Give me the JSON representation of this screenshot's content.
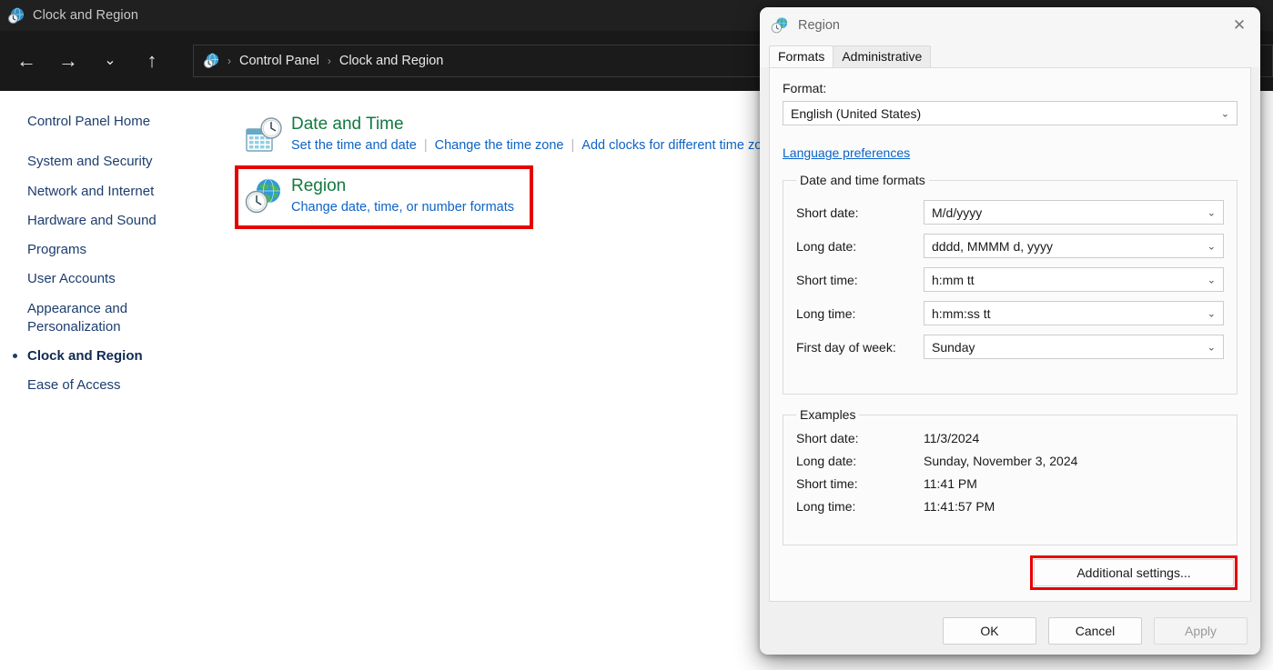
{
  "window": {
    "title": "Clock and Region",
    "title_icon": "clock-globe-icon",
    "nav": {
      "back_icon": "arrow-left-icon",
      "forward_icon": "arrow-right-icon",
      "recent_icon": "chevron-down-icon",
      "up_icon": "arrow-up-icon"
    },
    "breadcrumb": {
      "icon": "clock-globe-icon",
      "sep": "›",
      "items": [
        "Control Panel",
        "Clock and Region"
      ]
    }
  },
  "sidebar": {
    "home": "Control Panel Home",
    "items": [
      {
        "label": "System and Security",
        "current": false
      },
      {
        "label": "Network and Internet",
        "current": false
      },
      {
        "label": "Hardware and Sound",
        "current": false
      },
      {
        "label": "Programs",
        "current": false
      },
      {
        "label": "User Accounts",
        "current": false
      },
      {
        "label": "Appearance and Personalization",
        "current": false
      },
      {
        "label": "Clock and Region",
        "current": true
      },
      {
        "label": "Ease of Access",
        "current": false
      }
    ]
  },
  "main": {
    "groups": [
      {
        "icon": "calendar-clock-icon",
        "title": "Date and Time",
        "links": [
          "Set the time and date",
          "Change the time zone",
          "Add clocks for different time zones"
        ],
        "highlighted": false
      },
      {
        "icon": "globe-clock-icon",
        "title": "Region",
        "links": [
          "Change date, time, or number formats"
        ],
        "highlighted": true
      }
    ]
  },
  "dialog": {
    "title": "Region",
    "title_icon": "globe-clock-icon",
    "close_icon": "close-icon",
    "tabs": [
      {
        "label": "Formats",
        "active": true
      },
      {
        "label": "Administrative",
        "active": false
      }
    ],
    "format_label": "Format:",
    "format_value": "English (United States)",
    "language_preferences_link": "Language preferences",
    "datetime_group_label": "Date and time formats",
    "datetime_rows": [
      {
        "label": "Short date:",
        "value": "M/d/yyyy"
      },
      {
        "label": "Long date:",
        "value": "dddd, MMMM d, yyyy"
      },
      {
        "label": "Short time:",
        "value": "h:mm tt"
      },
      {
        "label": "Long time:",
        "value": "h:mm:ss tt"
      },
      {
        "label": "First day of week:",
        "value": "Sunday"
      }
    ],
    "examples_group_label": "Examples",
    "examples_rows": [
      {
        "label": "Short date:",
        "value": "11/3/2024"
      },
      {
        "label": "Long date:",
        "value": "Sunday, November 3, 2024"
      },
      {
        "label": "Short time:",
        "value": "11:41 PM"
      },
      {
        "label": "Long time:",
        "value": "11:41:57 PM"
      }
    ],
    "additional_settings_label": "Additional settings...",
    "buttons": {
      "ok": "OK",
      "cancel": "Cancel",
      "apply": "Apply"
    }
  },
  "colors": {
    "highlight_red": "#e60000",
    "heading_green": "#12793f",
    "link_blue": "#0d63c5",
    "sidebar_blue": "#1c3d6e",
    "titlebar_dark": "#202020"
  }
}
